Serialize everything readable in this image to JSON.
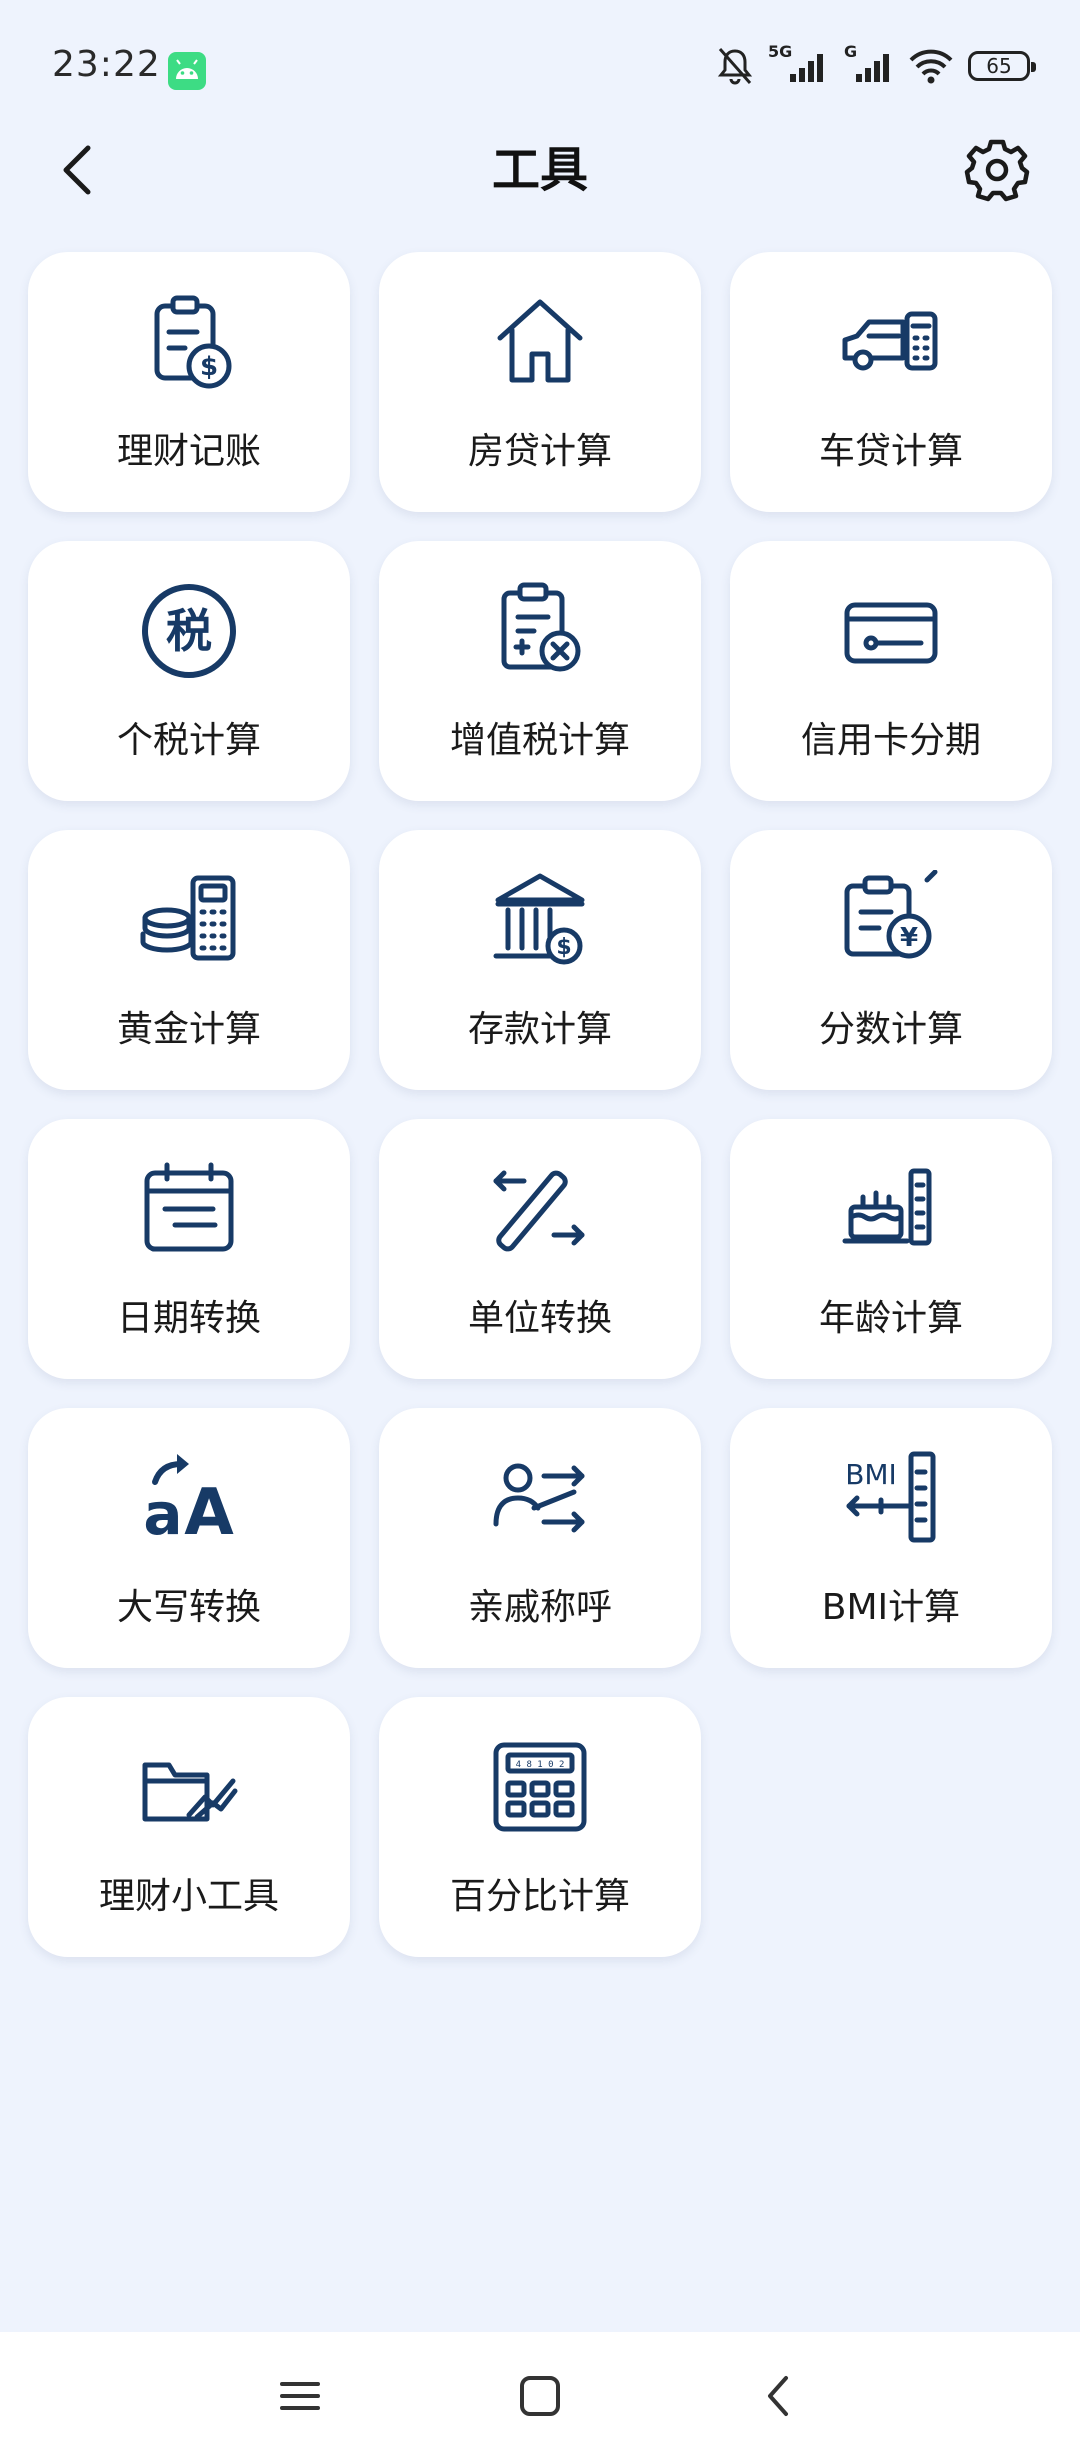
{
  "status_bar": {
    "time": "23:22",
    "network_label_1": "5G",
    "network_label_2": "G",
    "battery": "65"
  },
  "header": {
    "title": "工具"
  },
  "tools": [
    {
      "label": "理财记账",
      "icon": "clipboard-dollar-icon"
    },
    {
      "label": "房贷计算",
      "icon": "house-icon"
    },
    {
      "label": "车贷计算",
      "icon": "car-calculator-icon"
    },
    {
      "label": "个税计算",
      "icon": "tax-char-icon"
    },
    {
      "label": "增值税计算",
      "icon": "clipboard-multiply-icon"
    },
    {
      "label": "信用卡分期",
      "icon": "credit-card-icon"
    },
    {
      "label": "黄金计算",
      "icon": "coins-calculator-icon"
    },
    {
      "label": "存款计算",
      "icon": "bank-dollar-icon"
    },
    {
      "label": "分数计算",
      "icon": "clipboard-yen-icon"
    },
    {
      "label": "日期转换",
      "icon": "calendar-icon"
    },
    {
      "label": "单位转换",
      "icon": "ruler-arrows-icon"
    },
    {
      "label": "年龄计算",
      "icon": "cake-ruler-icon"
    },
    {
      "label": "大写转换",
      "icon": "case-convert-icon"
    },
    {
      "label": "亲戚称呼",
      "icon": "person-arrows-icon"
    },
    {
      "label": "BMI计算",
      "icon": "bmi-ruler-icon"
    },
    {
      "label": "理财小工具",
      "icon": "folder-chart-icon"
    },
    {
      "label": "百分比计算",
      "icon": "calculator-icon"
    }
  ],
  "icon_text": {
    "tax_char": "税",
    "case_small": "a",
    "case_big": "A",
    "bmi": "BMI",
    "yen": "¥",
    "dollar": "$",
    "calc_display": "4 8 1 0 2"
  },
  "colors": {
    "icon": "#173a66",
    "background": "#eef3fd",
    "tile": "#ffffff"
  }
}
